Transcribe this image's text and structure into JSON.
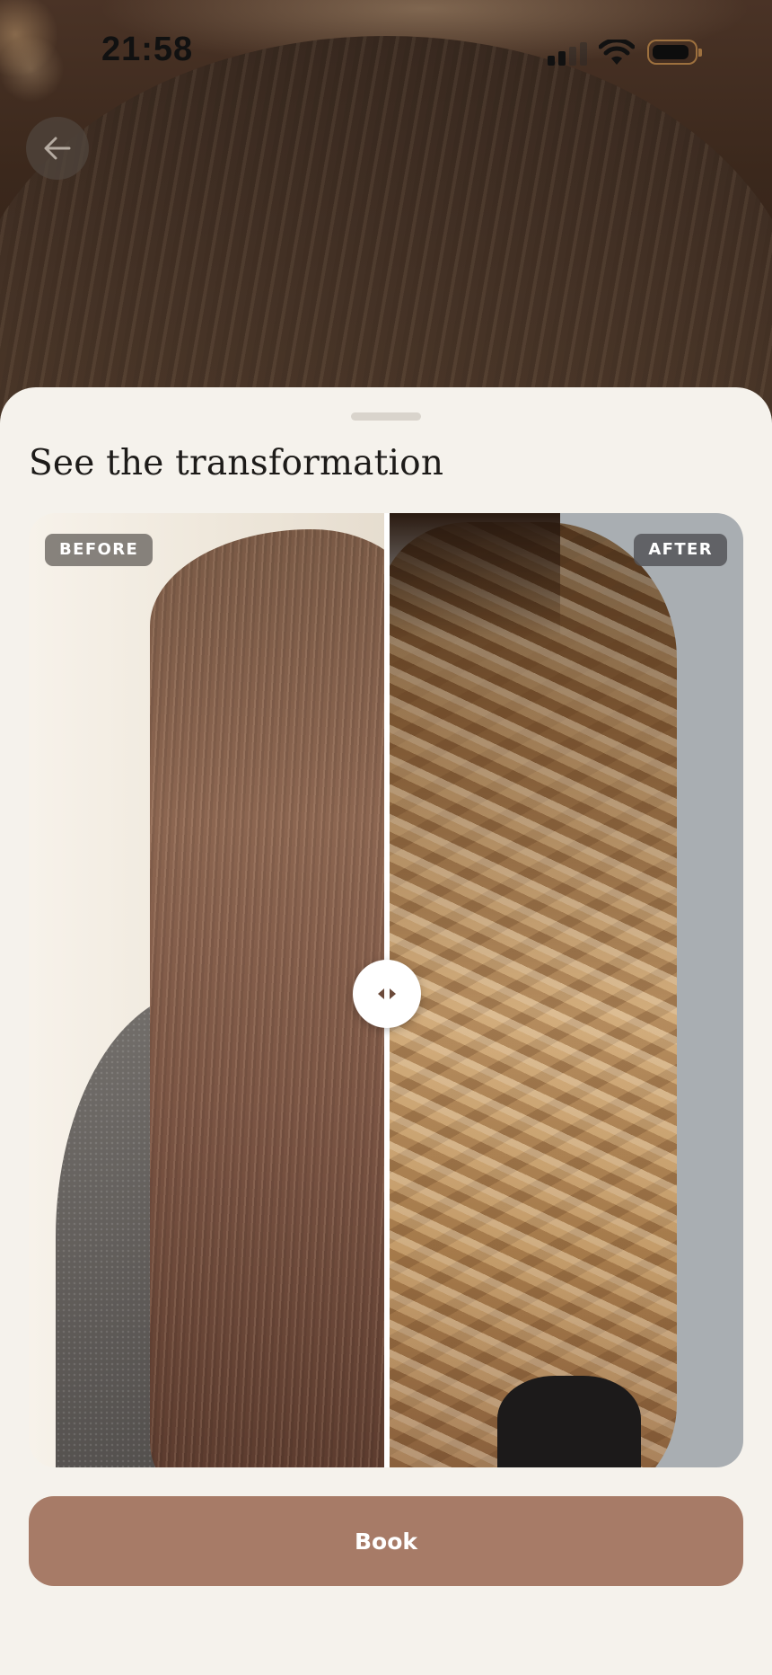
{
  "status_bar": {
    "time": "21:58",
    "icons": [
      "cellular-signal-icon",
      "wifi-icon",
      "battery-icon"
    ]
  },
  "hero": {
    "back_icon": "arrow-left-icon"
  },
  "sheet": {
    "title": "See the transformation",
    "comparison": {
      "before_label": "BEFORE",
      "after_label": "AFTER",
      "slider_position": 0.5,
      "handle_icon": "arrows-left-right-icon"
    },
    "book_label": "Book"
  },
  "colors": {
    "sheet_background": "#f5f2ec",
    "book_button": "#a77b67",
    "title_text": "#1d1b19",
    "after_background": "#a9aeb2"
  }
}
